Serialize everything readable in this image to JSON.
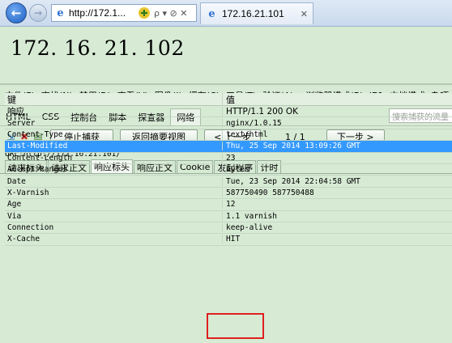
{
  "browser": {
    "address": "http://172.1...",
    "tab_title": "172.16.21.101",
    "back_glyph": "←",
    "forward_glyph": "→",
    "compat_glyph": "✚",
    "addr_tools": "ρ ▾ ⊘ ✕",
    "tab_close": "✕"
  },
  "page": {
    "heading": "172. 16. 21. 102"
  },
  "devtools": {
    "menu": [
      "文件(F)",
      "查找(N)",
      "禁用(D)",
      "查看(V)",
      "图像(I)",
      "缓存(C)",
      "工具(T)",
      "验证(A)"
    ],
    "browser_mode": "浏览器模式(B): IE9",
    "doc_mode": "文档模式: 杂项",
    "tabs": [
      "HTML",
      "CSS",
      "控制台",
      "脚本",
      "探查器",
      "网络"
    ],
    "active_tab": "网络",
    "search_placeholder": "搜索捕获的流量",
    "actions": {
      "stop_capture": "停止捕获",
      "back_to_summary": "返回摘要视图",
      "prev": "< 上一步",
      "page": "1 / 1",
      "next": "下一步 >"
    },
    "url_line": "URL:http://172.16.21.101/",
    "subtabs": [
      "请求标头",
      "请求正文",
      "响应标头",
      "响应正文",
      "Cookie",
      "发起程序",
      "计时"
    ],
    "active_subtab": "响应标头",
    "table": {
      "col_key": "键",
      "col_value": "值",
      "rows": [
        {
          "key": "响应",
          "value": "HTTP/1.1 200 OK"
        },
        {
          "key": "Server",
          "value": "nginx/1.0.15"
        },
        {
          "key": "Content-Type",
          "value": "text/html"
        },
        {
          "key": "Last-Modified",
          "value": "Thu, 25 Sep 2014 13:09:26 GMT"
        },
        {
          "key": "Content-Length",
          "value": "23"
        },
        {
          "key": "Accept-Ranges",
          "value": "bytes"
        },
        {
          "key": "Date",
          "value": "Tue, 23 Sep 2014 22:04:58 GMT"
        },
        {
          "key": "X-Varnish",
          "value": "587750490 587750488"
        },
        {
          "key": "Age",
          "value": "12"
        },
        {
          "key": "Via",
          "value": "1.1 varnish"
        },
        {
          "key": "Connection",
          "value": "keep-alive"
        },
        {
          "key": "X-Cache",
          "value": "HIT"
        }
      ],
      "selected_row": "Last-Modified"
    },
    "highlight_color": "#e02020",
    "selection_color": "#3399ff"
  }
}
